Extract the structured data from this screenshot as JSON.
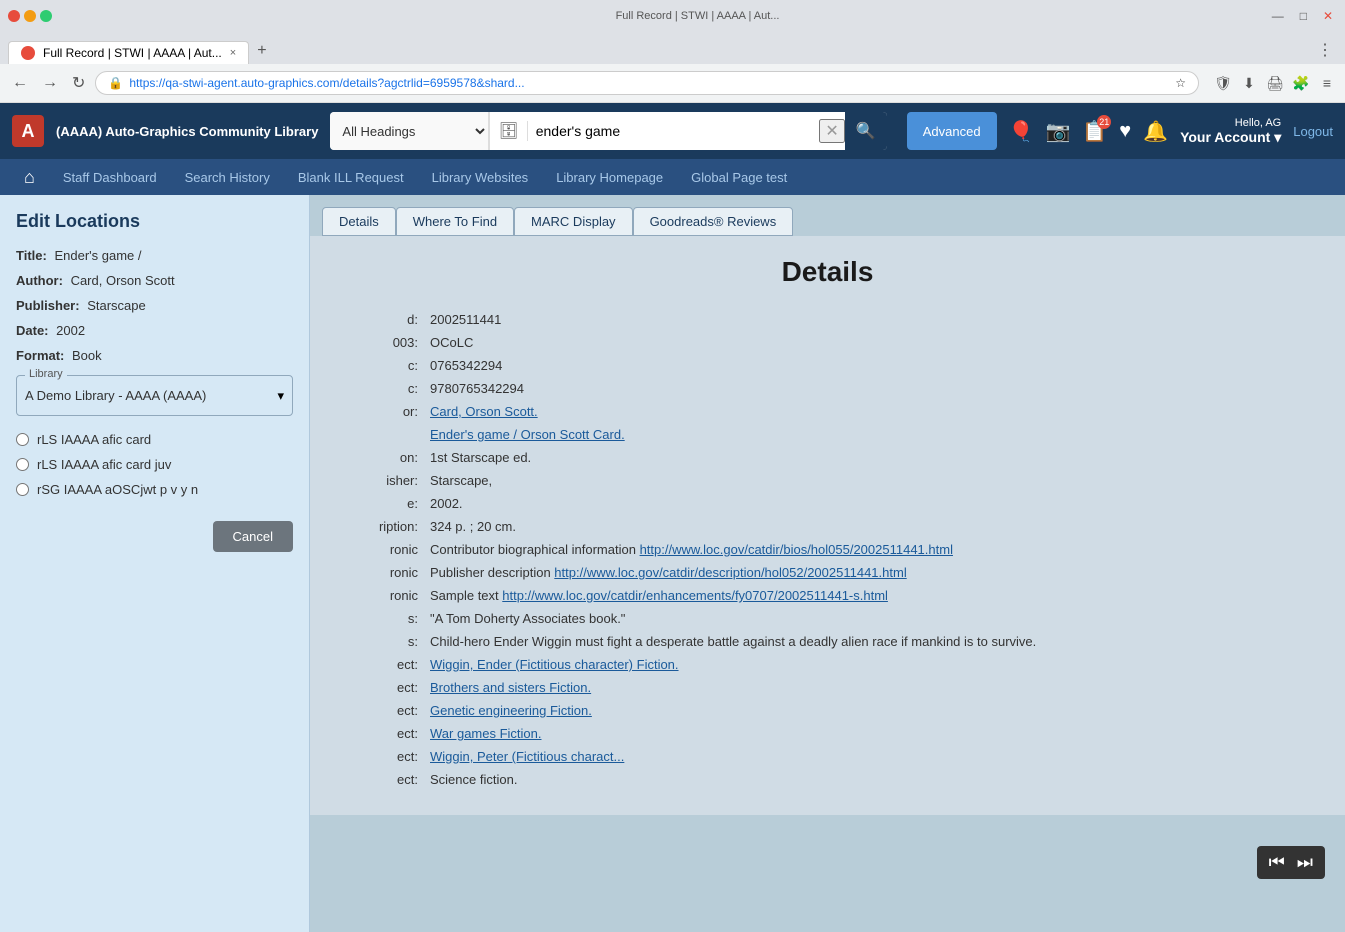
{
  "browser": {
    "title": "Full Record | STWI | AAAA | Aut...",
    "tab_close": "×",
    "new_tab": "+",
    "address": "https://qa-stwi-agent.auto-graphics.com/details?agctrlid=6959578&shard...",
    "window_min": "—",
    "window_max": "□",
    "window_close": "✕"
  },
  "header": {
    "app_name": "(AAAA) Auto-Graphics Community Library",
    "logo_text": "A",
    "search_placeholder": "ender's game",
    "search_type": "All Headings",
    "advanced_label": "Advanced",
    "hello": "Hello, AG",
    "your_account": "Your Account",
    "logout": "Logout",
    "badge_count": "21"
  },
  "nav": {
    "home_icon": "⌂",
    "items": [
      {
        "label": "Staff Dashboard"
      },
      {
        "label": "Search History"
      },
      {
        "label": "Blank ILL Request"
      },
      {
        "label": "Library Websites"
      },
      {
        "label": "Library Homepage"
      },
      {
        "label": "Global Page test"
      }
    ]
  },
  "left_panel": {
    "title": "Edit Locations",
    "fields": [
      {
        "label": "Title:",
        "value": "Ender's game /"
      },
      {
        "label": "Author:",
        "value": "Card, Orson Scott"
      },
      {
        "label": "Publisher:",
        "value": "Starscape"
      },
      {
        "label": "Date:",
        "value": "2002"
      },
      {
        "label": "Format:",
        "value": "Book"
      }
    ],
    "library_group_label": "Library",
    "library_option": "A Demo Library - AAAA (AAAA)",
    "radio_options": [
      {
        "id": "r1",
        "label": "rLS IAAAA afic card"
      },
      {
        "id": "r2",
        "label": "rLS IAAAA afic card juv"
      },
      {
        "id": "r3",
        "label": "rSG IAAAA aOSCjwt p v y n"
      }
    ],
    "cancel_label": "Cancel"
  },
  "content": {
    "tabs": [
      {
        "label": "Details"
      },
      {
        "label": "Where To Find"
      },
      {
        "label": "MARC Display"
      },
      {
        "label": "Goodreads® Reviews"
      }
    ],
    "details_title": "Details",
    "rows": [
      {
        "key": "d:",
        "value": "2002511441",
        "link": false
      },
      {
        "key": "003:",
        "value": "OCoLC",
        "link": false
      },
      {
        "key": "c:",
        "value": "0765342294",
        "link": false
      },
      {
        "key": "c:",
        "value": "9780765342294",
        "link": false
      },
      {
        "key": "or:",
        "value": "",
        "link_text": "Card, Orson Scott.",
        "link": true
      },
      {
        "key": "",
        "value": "",
        "link_text": "Ender's game / Orson Scott Card.",
        "link": true
      },
      {
        "key": "on:",
        "value": "1st Starscape ed.",
        "link": false
      },
      {
        "key": "isher:",
        "value": "Starscape,",
        "link": false
      },
      {
        "key": "e:",
        "value": "2002.",
        "link": false
      },
      {
        "key": "ription:",
        "value": "324 p. ; 20 cm.",
        "link": false
      },
      {
        "key": "ronic",
        "value": "Contributor biographical information ",
        "link": false,
        "url": "http://www.loc.gov/catdir/bios/hol055/2002511441.html"
      },
      {
        "key": "ronic",
        "value": "Publisher description ",
        "link": false,
        "url": "http://www.loc.gov/catdir/description/hol052/2002511441.html"
      },
      {
        "key": "ronic",
        "value": "Sample text ",
        "link": false,
        "url": "http://www.loc.gov/catdir/enhancements/fy0707/2002511441-s.html"
      },
      {
        "key": "s:",
        "value": "\"A Tom Doherty Associates book.\"",
        "link": false
      },
      {
        "key": "s:",
        "value": "Child-hero Ender Wiggin must fight a desperate battle against a deadly alien race if mankind is to survive.",
        "link": false
      },
      {
        "key": "ect:",
        "value": "",
        "link_text": "Wiggin, Ender (Fictitious character) Fiction.",
        "link": true
      },
      {
        "key": "ect:",
        "value": "",
        "link_text": "Brothers and sisters Fiction.",
        "link": true
      },
      {
        "key": "ect:",
        "value": "",
        "link_text": "Genetic engineering Fiction.",
        "link": true
      },
      {
        "key": "ect:",
        "value": "",
        "link_text": "War games Fiction.",
        "link": true
      },
      {
        "key": "ect:",
        "value": "",
        "link_text": "Wiggin, Peter (Fictitious charact...",
        "link": true
      },
      {
        "key": "ect:",
        "value": "Science fiction.",
        "link": false
      }
    ]
  },
  "media_controls": {
    "prev": "⏮",
    "next": "⏭"
  },
  "icons": {
    "search": "🔍",
    "clear": "✕",
    "balloon": "🎈",
    "camera": "📷",
    "list": "📋",
    "heart": "♥",
    "bell": "🔔",
    "chevron_down": "▾",
    "star": "☆",
    "shield": "🛡",
    "download": "⬇",
    "print": "🖨",
    "puzzle": "🧩",
    "menu": "≡",
    "db": "🗄",
    "back": "←",
    "forward": "→",
    "refresh": "↻",
    "home_nav": "⌂",
    "lock": "🔒",
    "bookmark": "☆"
  }
}
